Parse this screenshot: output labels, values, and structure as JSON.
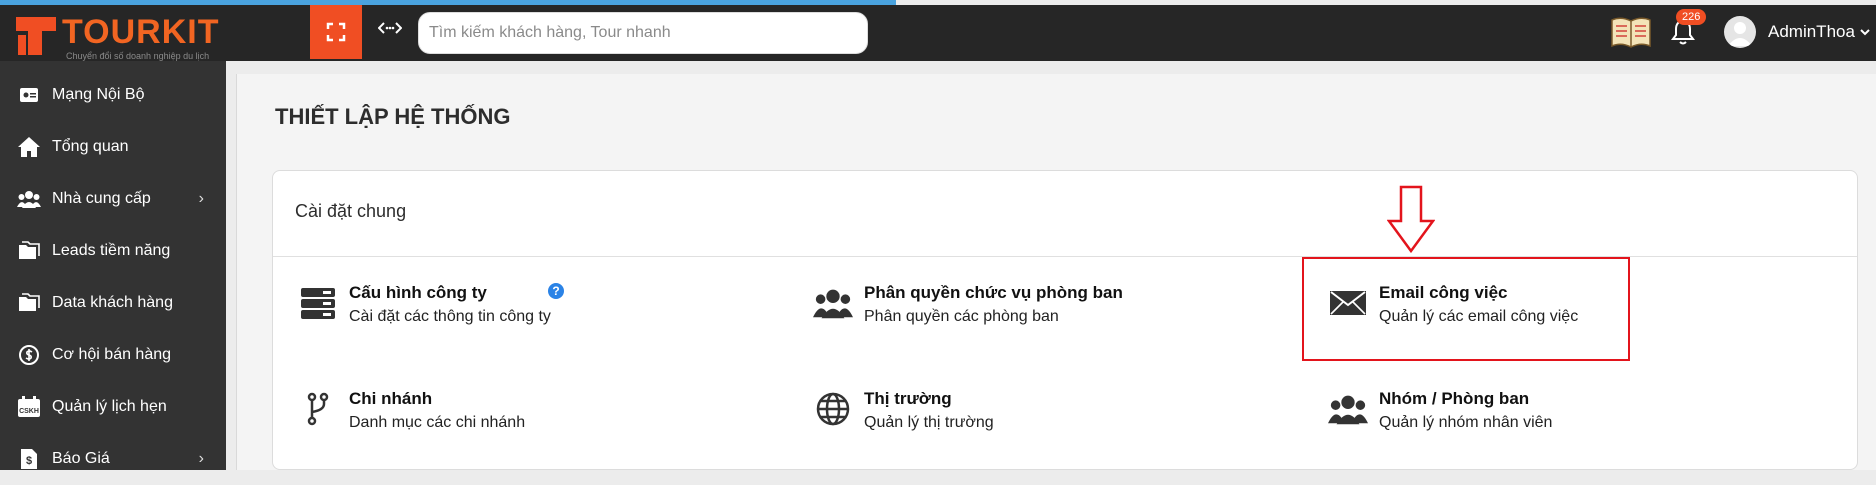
{
  "header": {
    "logo_text": "TOURKIT",
    "logo_sub": "Chuyển đổi số doanh nghiệp du lịch",
    "search_placeholder": "Tìm kiếm khách hàng, Tour nhanh",
    "notification_count": "226",
    "user_name": "AdminThoa",
    "accent_color": "#f04e23"
  },
  "sidebar": {
    "items": [
      {
        "label": "Mạng Nội Bộ",
        "icon": "id-card-icon"
      },
      {
        "label": "Tổng quan",
        "icon": "home-icon"
      },
      {
        "label": "Nhà cung cấp",
        "icon": "users-icon",
        "has_submenu": true
      },
      {
        "label": "Leads tiềm năng",
        "icon": "folders-icon"
      },
      {
        "label": "Data khách hàng",
        "icon": "folders-icon"
      },
      {
        "label": "Cơ hội bán hàng",
        "icon": "dollar-circle-icon"
      },
      {
        "label": "Quản lý lịch hẹn",
        "icon": "calendar-icon",
        "icon_text": "CSKH"
      },
      {
        "label": "Báo Giá",
        "icon": "invoice-icon",
        "has_submenu": true
      }
    ]
  },
  "page": {
    "title": "THIẾT LẬP HỆ THỐNG",
    "card_title": "Cài đặt chung",
    "help_symbol": "?",
    "tiles": [
      {
        "title": "Cấu hình công ty",
        "desc": "Cài đặt các thông tin công ty",
        "icon": "server-icon"
      },
      {
        "title": "Phân quyền chức vụ phòng ban",
        "desc": "Phân quyền các phòng ban",
        "icon": "users-icon"
      },
      {
        "title": "Email công việc",
        "desc": "Quản lý các email công việc",
        "icon": "envelope-icon"
      },
      {
        "title": "Chi nhánh",
        "desc": "Danh mục các chi nhánh",
        "icon": "branch-icon"
      },
      {
        "title": "Thị trường",
        "desc": "Quản lý thị trường",
        "icon": "globe-icon"
      },
      {
        "title": "Nhóm / Phòng ban",
        "desc": "Quản lý nhóm nhân viên",
        "icon": "users-icon"
      }
    ]
  }
}
